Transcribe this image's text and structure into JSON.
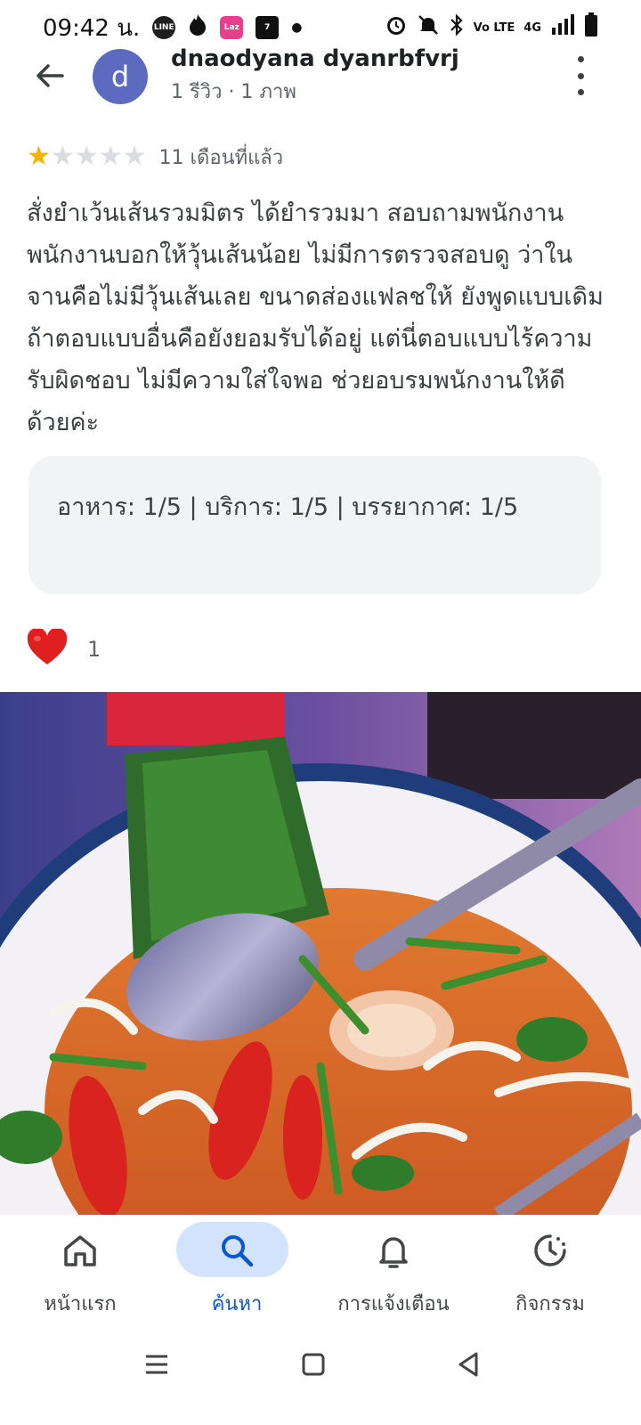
{
  "status_bar": {
    "time": "09:42 น.",
    "apps": [
      "LINE",
      "Laz",
      "7"
    ],
    "network": "4G",
    "volte": "Vo LTE"
  },
  "header": {
    "avatar_letter": "d",
    "reviewer_name": "dnaodyana dyanrbfvrj",
    "reviewer_meta": "1 รีวิว · 1 ภาพ"
  },
  "review": {
    "rating": 1,
    "rating_max": 5,
    "time_ago": "11 เดือนที่แล้ว",
    "text": "สั่งยำเว้นเส้นรวมมิตร ได้ยำรวมมา สอบถามพนักงาน พนักงานบอกให้วุ้นเส้นน้อย ไม่มีการตรวจสอบดู ว่าในจานคือไม่มีวุ้นเส้นเลย ขนาดส่องแฟลชให้ ยังพูดแบบเดิม ถ้าตอบแบบอื่นคือยังยอมรับได้อยู่ แต่นี่ตอบแบบไร้ความรับผิดชอบ ไม่มีความใส่ใจพอ ช่วยอบรมพนักงานให้ดีด้วยค่ะ",
    "scores": "อาหาร: 1/5  |  บริการ: 1/5  |  บรรยากาศ: 1/5",
    "likes": "1"
  },
  "bottom_nav": {
    "items": [
      {
        "label": "หน้าแรก",
        "icon": "home-icon"
      },
      {
        "label": "ค้นหา",
        "icon": "search-icon"
      },
      {
        "label": "การแจ้งเตือน",
        "icon": "bell-icon"
      },
      {
        "label": "กิจกรรม",
        "icon": "activity-icon"
      }
    ],
    "active_index": 1
  },
  "colors": {
    "accent": "#0b57d0",
    "active_pill": "#d3e3fd",
    "star": "#f4b400",
    "avatar": "#5c6bc0"
  }
}
